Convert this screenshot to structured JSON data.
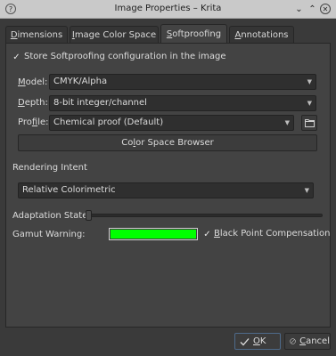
{
  "window": {
    "title": "Image Properties – Krita"
  },
  "tabs": [
    {
      "pre": "",
      "ul": "D",
      "post": "imensions"
    },
    {
      "pre": "",
      "ul": "I",
      "post": "mage Color Space"
    },
    {
      "pre": "",
      "ul": "S",
      "post": "oftproofing"
    },
    {
      "pre": "",
      "ul": "A",
      "post": "nnotations"
    }
  ],
  "softproofing": {
    "store_label": "Store Softproofing configuration in the image",
    "store_checked": true,
    "model_label_ul": "M",
    "model_label_rest": "odel:",
    "model_value": "CMYK/Alpha",
    "depth_label_ul": "D",
    "depth_label_rest": "epth:",
    "depth_value": "8-bit integer/channel",
    "profile_label_pre": "Pro",
    "profile_label_ul": "f",
    "profile_label_rest": "ile:",
    "profile_value": "Chemical proof (Default)",
    "browser_pre": "Co",
    "browser_ul": "l",
    "browser_post": "or Space Browser",
    "rendering_intent_label": "Rendering Intent",
    "rendering_intent_value": "Relative Colorimetric",
    "adaptation_label": "Adaptation State:",
    "adaptation_value": 0,
    "gamut_label": "Gamut Warning:",
    "gamut_color": "#00ff00",
    "bpc_label_ul": "B",
    "bpc_label_rest": "lack Point Compensation",
    "bpc_checked": true
  },
  "footer": {
    "ok_ul": "O",
    "ok_rest": "K",
    "cancel_ul": "C",
    "cancel_rest": "ancel"
  },
  "icons": {
    "ok": "check-icon",
    "cancel": "cancel-icon",
    "profile_browse": "folder-icon"
  }
}
